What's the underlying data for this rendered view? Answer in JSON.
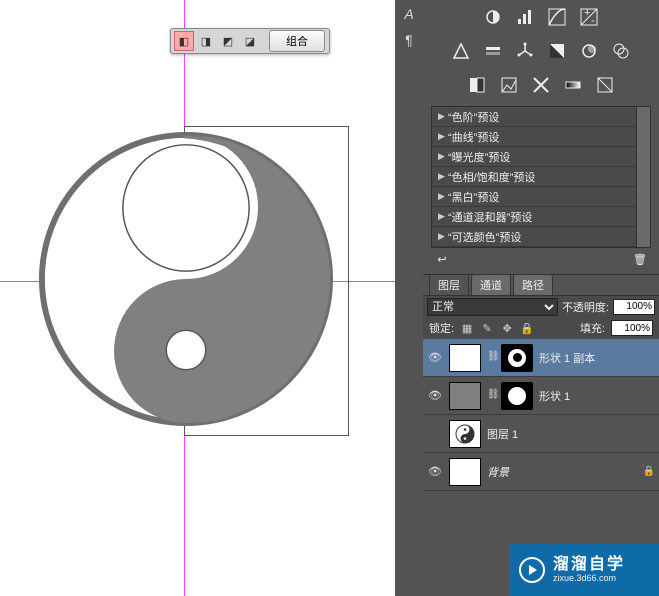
{
  "float_toolbar": {
    "combine_label": "组合"
  },
  "adjustments": {
    "presets": [
      "“色阶”预设",
      "“曲线”预设",
      "“曝光度”预设",
      "“色相/饱和度”预设",
      "“黑白”预设",
      "“通道混和器”预设",
      "“可选颜色”预设"
    ]
  },
  "layers_panel": {
    "tabs": {
      "layers": "图层",
      "channels": "通道",
      "paths": "路径"
    },
    "blend_mode": "正常",
    "opacity_label": "不透明度:",
    "opacity_value": "100%",
    "lock_label": "锁定:",
    "fill_label": "填充:",
    "fill_value": "100%",
    "layers": [
      {
        "name": "形状 1 副本",
        "visible": true,
        "mask": true,
        "selected": true,
        "kind": "shape"
      },
      {
        "name": "形状 1",
        "visible": true,
        "mask": true,
        "selected": false,
        "kind": "shape-gray"
      },
      {
        "name": "图层 1",
        "visible": false,
        "mask": false,
        "selected": false,
        "kind": "yinyang"
      },
      {
        "name": "背景",
        "visible": true,
        "mask": false,
        "selected": false,
        "kind": "bg"
      }
    ]
  },
  "watermark": {
    "brand": "溜溜自学",
    "url": "zixue.3d66.com"
  }
}
